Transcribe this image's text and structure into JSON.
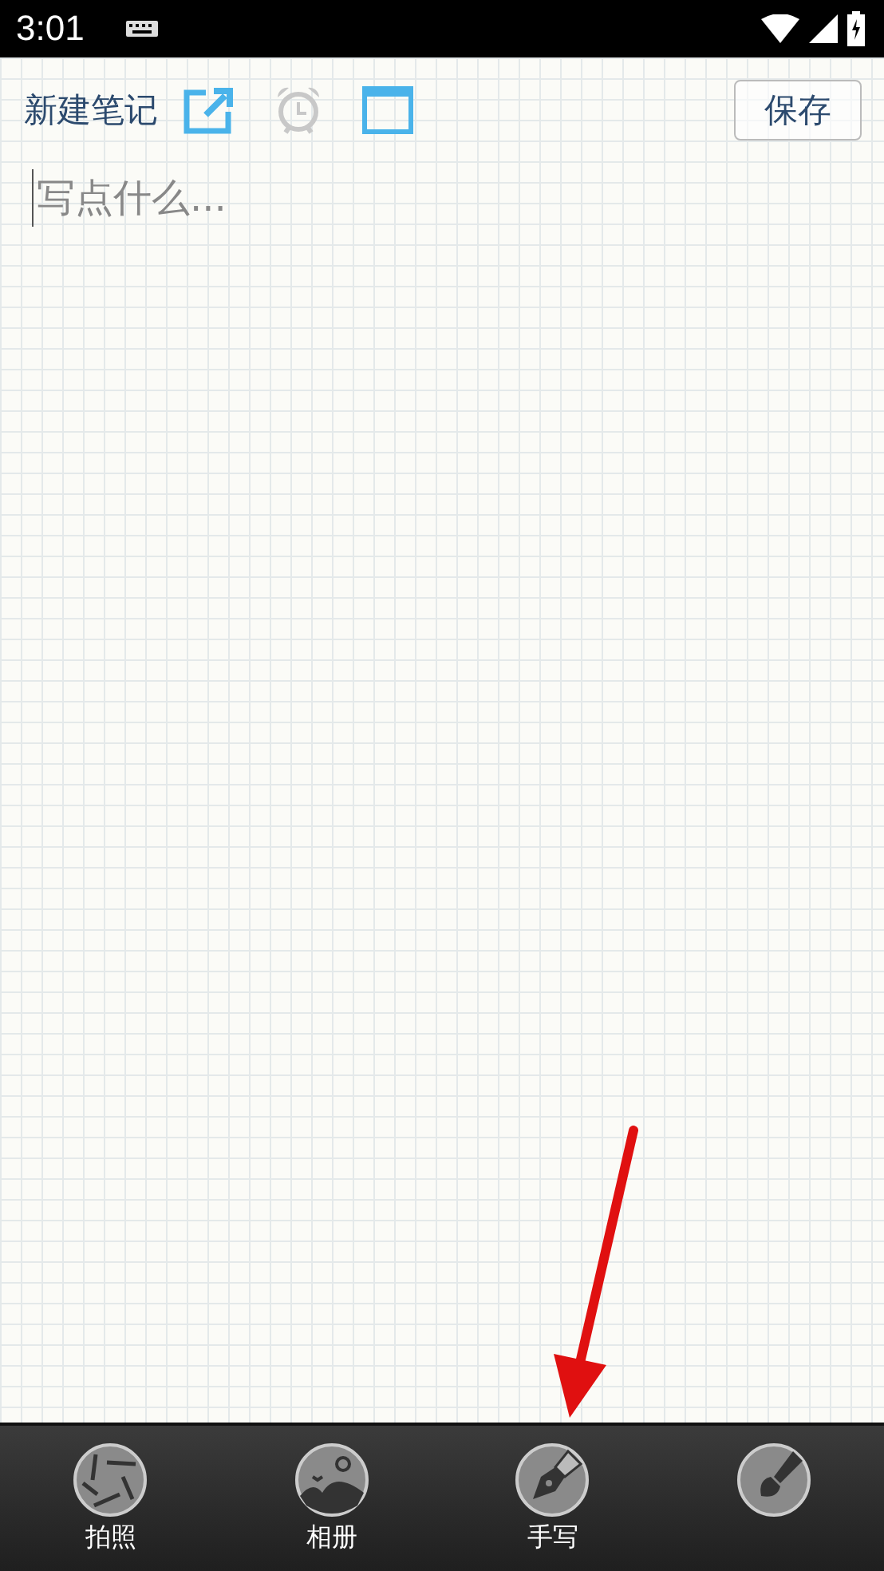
{
  "status_bar": {
    "time": "3:01"
  },
  "header": {
    "title": "新建笔记",
    "save": "保存"
  },
  "editor": {
    "placeholder": "写点什么..."
  },
  "tools": [
    {
      "kind": "camera",
      "label": "拍照"
    },
    {
      "kind": "gallery",
      "label": "相册"
    },
    {
      "kind": "pen",
      "label": "手写"
    },
    {
      "kind": "brush"
    }
  ]
}
